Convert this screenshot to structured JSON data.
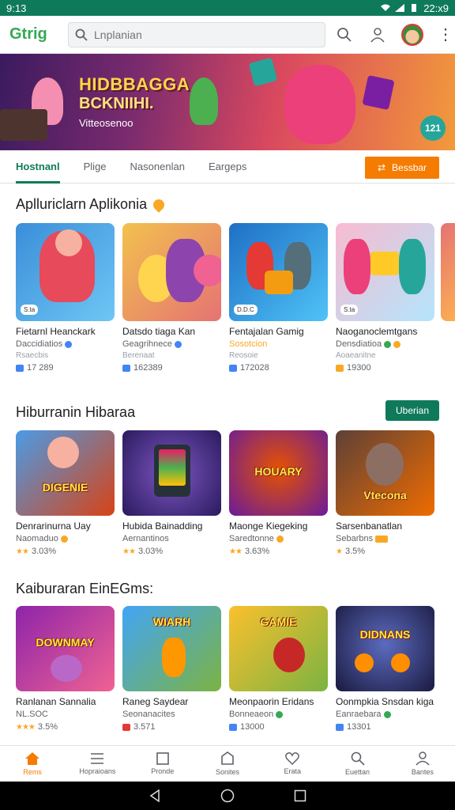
{
  "status_bar": {
    "time": "9:13",
    "right_text": "22:x9"
  },
  "header": {
    "logo": "Gtrig",
    "search_placeholder": "Lnplanian"
  },
  "banner": {
    "title": "HIDBBAGGA",
    "subtitle": "BCKNIIHI.",
    "tagline": "Vitteosenoo",
    "badge": "121"
  },
  "tabs": [
    "Hostnanl",
    "Plige",
    "Nasonenlan",
    "Eargeps"
  ],
  "orange_button": "Bessbar",
  "sections": [
    {
      "title": "Aplluriclarn Aplikonia",
      "cards": [
        {
          "title": "Fietarnl Heanckark",
          "sub": "Daccidiatios",
          "dev": "Rsaecbis",
          "meta": "17 289",
          "pill": "S.ta",
          "colors": [
            "#3b8ed8",
            "#e64a5b"
          ]
        },
        {
          "title": "Datsdo tiaga Kan",
          "sub": "Geagrihnece",
          "dev": "Berenaat",
          "meta": "162389",
          "pill": "",
          "colors": [
            "#f2c14e",
            "#8e44ad"
          ]
        },
        {
          "title": "Fentajalan Gamig",
          "sub": "Sosotcion",
          "dev": "Reosoie",
          "meta": "172028",
          "pill": "D.D.C",
          "colors": [
            "#1f6fc5",
            "#f39c12"
          ]
        },
        {
          "title": "Naoganoclemtgans",
          "sub": "Densdiatioa",
          "dev": "Aoaeanitne",
          "meta": "19300",
          "pill": "S.ta",
          "colors": [
            "#f48fb1",
            "#26a69a"
          ]
        }
      ]
    },
    {
      "title": "Hiburranin Hibaraa",
      "button": "Uberian",
      "cards": [
        {
          "title": "Denrarinurna Uay",
          "sub": "Naomaduo",
          "meta": "3.03%",
          "caption": "DIGENIE",
          "colors": [
            "#4a9be6",
            "#d84315"
          ]
        },
        {
          "title": "Hubida Bainadding",
          "sub": "Aernantinos",
          "meta": "3.03%",
          "caption": "",
          "colors": [
            "#2a1a5e",
            "#7e57c2"
          ]
        },
        {
          "title": "Maonge Kiegeking",
          "sub": "Saredtonne",
          "meta": "3.63%",
          "caption": "HOUARY",
          "colors": [
            "#6a1b9a",
            "#e65100"
          ]
        },
        {
          "title": "Sarsenbanatlan",
          "sub": "Sebarbns",
          "meta": "3.5%",
          "caption": "Vtecona",
          "colors": [
            "#5d4037",
            "#ef6c00"
          ]
        }
      ]
    },
    {
      "title": "Kaiburaran EinEGms:",
      "cards": [
        {
          "title": "Ranlanan Sannalia",
          "sub": "NL.SOC",
          "meta": "3.5%",
          "caption": "DOWNMAY",
          "colors": [
            "#8e24aa",
            "#f06292"
          ]
        },
        {
          "title": "Raneg Saydear",
          "sub": "Seonanacites",
          "meta": "3.571",
          "caption": "WIARH",
          "colors": [
            "#42a5f5",
            "#7cb342"
          ]
        },
        {
          "title": "Meonpaorin Eridans",
          "sub": "Bonneaeon",
          "meta": "13000",
          "caption": "GAMIE",
          "colors": [
            "#fbc02d",
            "#c62828"
          ]
        },
        {
          "title": "Oonmpkia Snsdan kiga",
          "sub": "Eanraebara",
          "meta": "13301",
          "caption": "DIDNANS",
          "colors": [
            "#283593",
            "#ff8f00"
          ]
        }
      ]
    }
  ],
  "bottom_nav": [
    "Rems",
    "Hopraioans",
    "Pronde",
    "Sonites",
    "Erata",
    "Euettan",
    "Bantes"
  ],
  "accent_colors": {
    "primary": "#0f7a5a",
    "orange": "#f57c00"
  }
}
